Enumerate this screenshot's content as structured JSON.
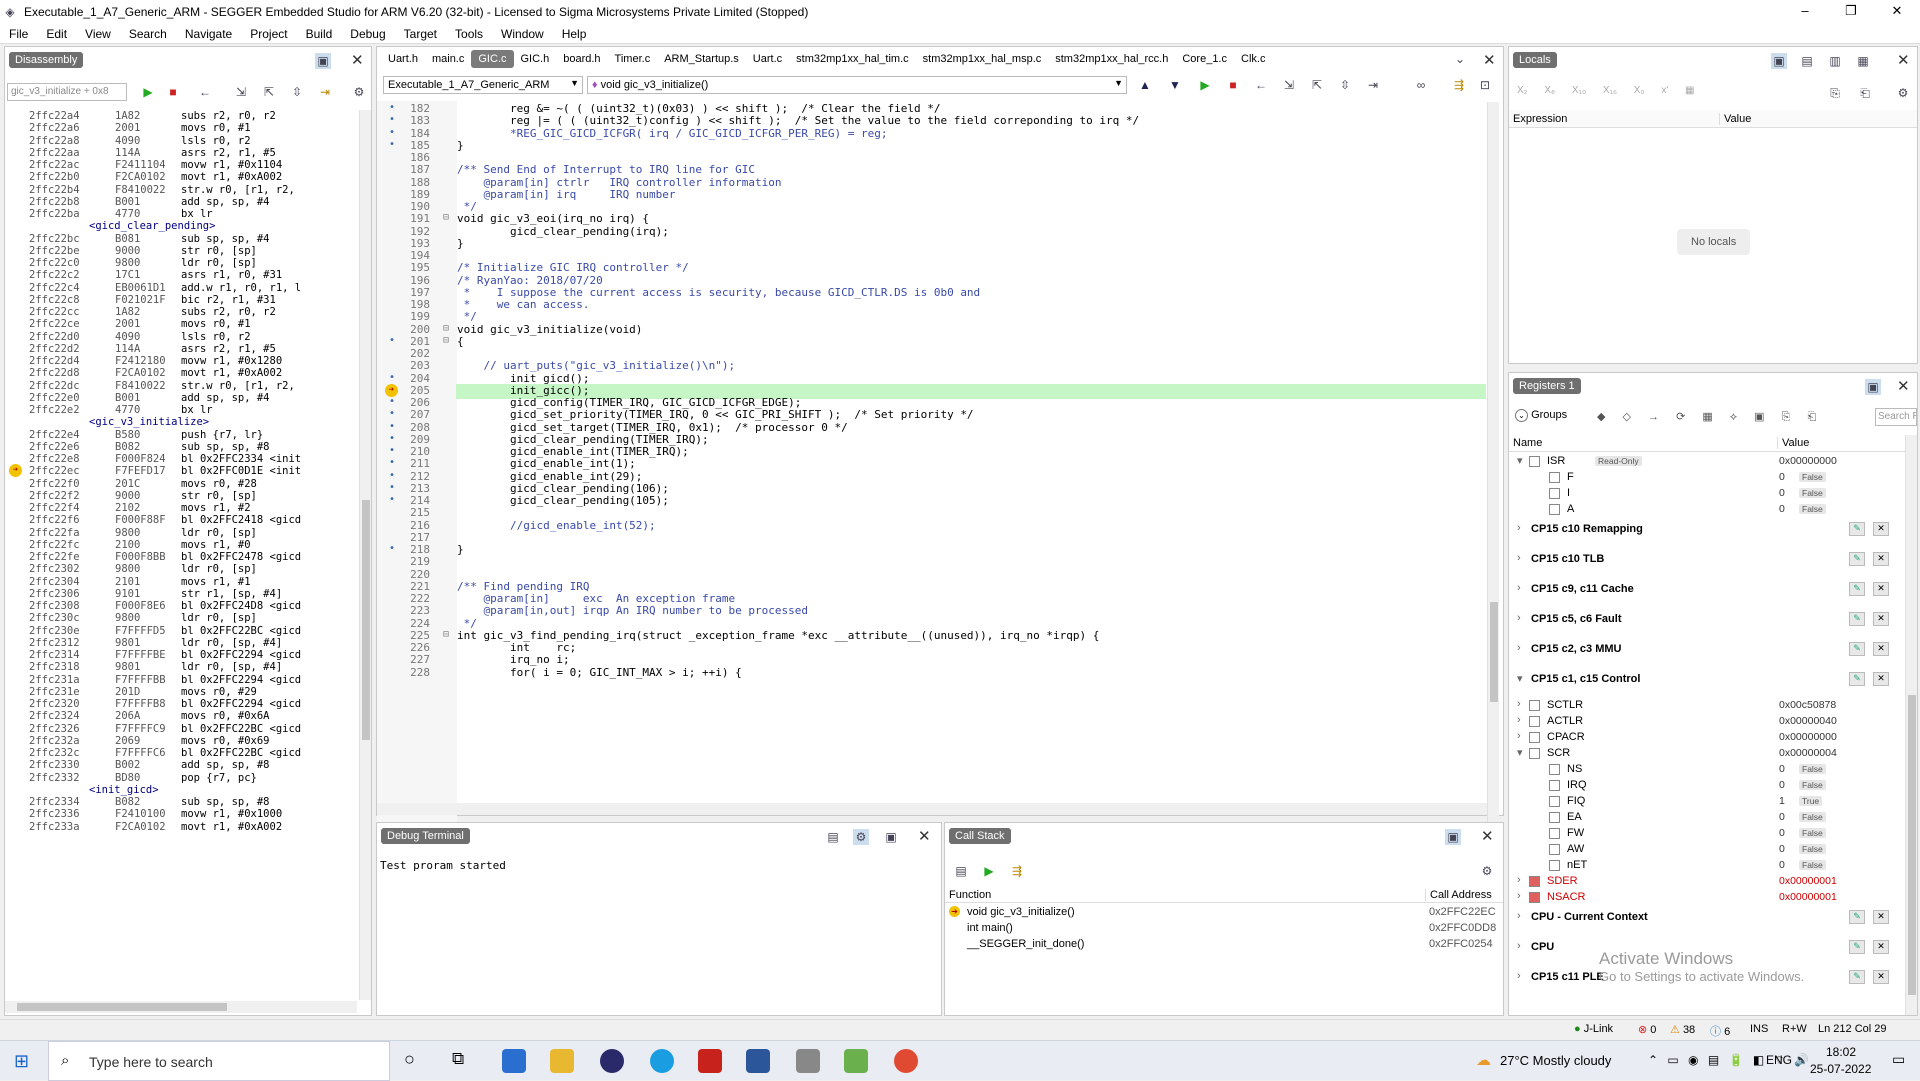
{
  "window": {
    "title": "Executable_1_A7_Generic_ARM - SEGGER Embedded Studio for ARM V6.20 (32-bit) - Licensed to Sigma Microsystems Private Limited (Stopped)"
  },
  "menu": [
    "File",
    "Edit",
    "View",
    "Search",
    "Navigate",
    "Project",
    "Build",
    "Debug",
    "Target",
    "Tools",
    "Window",
    "Help"
  ],
  "disassembly": {
    "title": "Disassembly",
    "address_input": "gic_v3_initialize + 0x8",
    "lines": [
      [
        "2ffc22a4",
        "1A82",
        "subs r2, r0, r2"
      ],
      [
        "2ffc22a6",
        "2001",
        "movs r0, #1"
      ],
      [
        "2ffc22a8",
        "4090",
        "lsls r0, r2"
      ],
      [
        "2ffc22aa",
        "114A",
        "asrs r2, r1, #5"
      ],
      [
        "2ffc22ac",
        "F2411104",
        "movw r1, #0x1104"
      ],
      [
        "2ffc22b0",
        "F2CA0102",
        "movt r1, #0xA002"
      ],
      [
        "2ffc22b4",
        "F8410022",
        "str.w r0, [r1, r2,"
      ],
      [
        "2ffc22b8",
        "B001",
        "add sp, sp, #4"
      ],
      [
        "2ffc22ba",
        "4770",
        "bx lr"
      ],
      [
        "",
        "<gicd_clear_pending>",
        ""
      ],
      [
        "2ffc22bc",
        "B081",
        "sub sp, sp, #4"
      ],
      [
        "2ffc22be",
        "9000",
        "str r0, [sp]"
      ],
      [
        "2ffc22c0",
        "9800",
        "ldr r0, [sp]"
      ],
      [
        "2ffc22c2",
        "17C1",
        "asrs r1, r0, #31"
      ],
      [
        "2ffc22c4",
        "EB0061D1",
        "add.w r1, r0, r1, l"
      ],
      [
        "2ffc22c8",
        "F021021F",
        "bic r2, r1, #31"
      ],
      [
        "2ffc22cc",
        "1A82",
        "subs r2, r0, r2"
      ],
      [
        "2ffc22ce",
        "2001",
        "movs r0, #1"
      ],
      [
        "2ffc22d0",
        "4090",
        "lsls r0, r2"
      ],
      [
        "2ffc22d2",
        "114A",
        "asrs r2, r1, #5"
      ],
      [
        "2ffc22d4",
        "F2412180",
        "movw r1, #0x1280"
      ],
      [
        "2ffc22d8",
        "F2CA0102",
        "movt r1, #0xA002"
      ],
      [
        "2ffc22dc",
        "F8410022",
        "str.w r0, [r1, r2,"
      ],
      [
        "2ffc22e0",
        "B001",
        "add sp, sp, #4"
      ],
      [
        "2ffc22e2",
        "4770",
        "bx lr"
      ],
      [
        "",
        "<gic_v3_initialize>",
        ""
      ],
      [
        "2ffc22e4",
        "B580",
        "push {r7, lr}"
      ],
      [
        "2ffc22e6",
        "B082",
        "sub sp, sp, #8"
      ],
      [
        "2ffc22e8",
        "F000F824",
        "bl 0x2FFC2334 <init"
      ],
      [
        "2ffc22ec",
        "F7FEFD17",
        "bl 0x2FFC0D1E <init"
      ],
      [
        "2ffc22f0",
        "201C",
        "movs r0, #28"
      ],
      [
        "2ffc22f2",
        "9000",
        "str r0, [sp]"
      ],
      [
        "2ffc22f4",
        "2102",
        "movs r1, #2"
      ],
      [
        "2ffc22f6",
        "F000F88F",
        "bl 0x2FFC2418 <gicd"
      ],
      [
        "2ffc22fa",
        "9800",
        "ldr r0, [sp]"
      ],
      [
        "2ffc22fc",
        "2100",
        "movs r1, #0"
      ],
      [
        "2ffc22fe",
        "F000F8BB",
        "bl 0x2FFC2478 <gicd"
      ],
      [
        "2ffc2302",
        "9800",
        "ldr r0, [sp]"
      ],
      [
        "2ffc2304",
        "2101",
        "movs r1, #1"
      ],
      [
        "2ffc2306",
        "9101",
        "str r1, [sp, #4]"
      ],
      [
        "2ffc2308",
        "F000F8E6",
        "bl 0x2FFC24D8 <gicd"
      ],
      [
        "2ffc230c",
        "9800",
        "ldr r0, [sp]"
      ],
      [
        "2ffc230e",
        "F7FFFFD5",
        "bl 0x2FFC22BC <gicd"
      ],
      [
        "2ffc2312",
        "9801",
        "ldr r0, [sp, #4]"
      ],
      [
        "2ffc2314",
        "F7FFFFBE",
        "bl 0x2FFC2294 <gicd"
      ],
      [
        "2ffc2318",
        "9801",
        "ldr r0, [sp, #4]"
      ],
      [
        "2ffc231a",
        "F7FFFFBB",
        "bl 0x2FFC2294 <gicd"
      ],
      [
        "2ffc231e",
        "201D",
        "movs r0, #29"
      ],
      [
        "2ffc2320",
        "F7FFFFB8",
        "bl 0x2FFC2294 <gicd"
      ],
      [
        "2ffc2324",
        "206A",
        "movs r0, #0x6A"
      ],
      [
        "2ffc2326",
        "F7FFFFC9",
        "bl 0x2FFC22BC <gicd"
      ],
      [
        "2ffc232a",
        "2069",
        "movs r0, #0x69"
      ],
      [
        "2ffc232c",
        "F7FFFFC6",
        "bl 0x2FFC22BC <gicd"
      ],
      [
        "2ffc2330",
        "B002",
        "add sp, sp, #8"
      ],
      [
        "2ffc2332",
        "BD80",
        "pop {r7, pc}"
      ],
      [
        "",
        "<init_gicd>",
        ""
      ],
      [
        "2ffc2334",
        "B082",
        "sub sp, sp, #8"
      ],
      [
        "2ffc2336",
        "F2410100",
        "movw r1, #0x1000"
      ],
      [
        "2ffc233a",
        "F2CA0102",
        "movt r1, #0xA002"
      ]
    ]
  },
  "editor": {
    "tabs": [
      "Uart.h",
      "main.c",
      "GIC.c",
      "GIC.h",
      "board.h",
      "Timer.c",
      "ARM_Startup.s",
      "Uart.c",
      "stm32mp1xx_hal_tim.c",
      "stm32mp1xx_hal_msp.c",
      "stm32mp1xx_hal_rcc.h",
      "Core_1.c",
      "Clk.c"
    ],
    "active_tab": "GIC.c",
    "project_dropdown": "Executable_1_A7_Generic_ARM",
    "function_dropdown": "void gic_v3_initialize()",
    "lines": [
      [
        "182",
        "        reg &= ~( ( (uint32_t)(0x03) ) << shift );  /* Clear the field */"
      ],
      [
        "183",
        "        reg |= ( ( (uint32_t)config ) << shift );  /* Set the value to the field correponding to irq */"
      ],
      [
        "184",
        "        *REG_GIC_GICD_ICFGR( irq / GIC_GICD_ICFGR_PER_REG) = reg;"
      ],
      [
        "185",
        "}"
      ],
      [
        "186",
        ""
      ],
      [
        "187",
        "/** Send End of Interrupt to IRQ line for GIC"
      ],
      [
        "188",
        "    @param[in] ctrlr   IRQ controller information"
      ],
      [
        "189",
        "    @param[in] irq     IRQ number"
      ],
      [
        "190",
        " */"
      ],
      [
        "191",
        "void gic_v3_eoi(irq_no irq) {"
      ],
      [
        "192",
        "        gicd_clear_pending(irq);"
      ],
      [
        "193",
        "}"
      ],
      [
        "194",
        ""
      ],
      [
        "195",
        "/* Initialize GIC IRQ controller */"
      ],
      [
        "196",
        "/* RyanYao: 2018/07/20"
      ],
      [
        "197",
        " *    I suppose the current access is security, because GICD_CTLR.DS is 0b0 and"
      ],
      [
        "198",
        " *    we can access."
      ],
      [
        "199",
        " */"
      ],
      [
        "200",
        "void gic_v3_initialize(void)"
      ],
      [
        "201",
        "{"
      ],
      [
        "202",
        ""
      ],
      [
        "203",
        "    // uart_puts(\"gic_v3_initialize()\\n\");"
      ],
      [
        "204",
        "        init_gicd();"
      ],
      [
        "205",
        "        init_gicc();"
      ],
      [
        "206",
        "        gicd_config(TIMER_IRQ, GIC_GICD_ICFGR_EDGE);"
      ],
      [
        "207",
        "        gicd_set_priority(TIMER_IRQ, 0 << GIC_PRI_SHIFT );  /* Set priority */"
      ],
      [
        "208",
        "        gicd_set_target(TIMER_IRQ, 0x1);  /* processor 0 */"
      ],
      [
        "209",
        "        gicd_clear_pending(TIMER_IRQ);"
      ],
      [
        "210",
        "        gicd_enable_int(TIMER_IRQ);"
      ],
      [
        "211",
        "        gicd_enable_int(1);"
      ],
      [
        "212",
        "        gicd_enable_int(29);"
      ],
      [
        "213",
        "        gicd_clear_pending(106);"
      ],
      [
        "214",
        "        gicd_clear_pending(105);"
      ],
      [
        "215",
        ""
      ],
      [
        "216",
        "        //gicd_enable_int(52);"
      ],
      [
        "217",
        ""
      ],
      [
        "218",
        "}"
      ],
      [
        "219",
        ""
      ],
      [
        "220",
        ""
      ],
      [
        "221",
        "/** Find pending IRQ"
      ],
      [
        "222",
        "    @param[in]     exc  An exception frame"
      ],
      [
        "223",
        "    @param[in,out] irqp An IRQ number to be processed"
      ],
      [
        "224",
        " */"
      ],
      [
        "225",
        "int gic_v3_find_pending_irq(struct _exception_frame *exc __attribute__((unused)), irq_no *irqp) {"
      ],
      [
        "226",
        "        int    rc;"
      ],
      [
        "227",
        "        irq_no i;"
      ],
      [
        "228",
        "        for( i = 0; GIC_INT_MAX > i; ++i) {"
      ]
    ]
  },
  "locals": {
    "title": "Locals",
    "col_expression": "Expression",
    "col_value": "Value",
    "empty": "No locals"
  },
  "registers": {
    "title": "Registers 1",
    "groups_label": "Groups",
    "search_placeholder": "Search R",
    "col_name": "Name",
    "col_value": "Value",
    "rows": [
      {
        "kind": "reg",
        "name": "ISR",
        "value": "0x00000000",
        "badge": "Read-Only",
        "indent": 1
      },
      {
        "kind": "bit",
        "name": "F",
        "value": "0",
        "flag": "False",
        "indent": 2
      },
      {
        "kind": "bit",
        "name": "I",
        "value": "0",
        "flag": "False",
        "indent": 2
      },
      {
        "kind": "bit",
        "name": "A",
        "value": "0",
        "flag": "False",
        "indent": 2
      },
      {
        "kind": "group",
        "name": "CP15 c10 Remapping"
      },
      {
        "kind": "group",
        "name": "CP15 c10 TLB"
      },
      {
        "kind": "group",
        "name": "CP15 c9, c11 Cache"
      },
      {
        "kind": "group",
        "name": "CP15 c5, c6 Fault"
      },
      {
        "kind": "group",
        "name": "CP15 c2, c3 MMU"
      },
      {
        "kind": "group",
        "name": "CP15 c1, c15 Control"
      },
      {
        "kind": "reg",
        "name": "SCTLR",
        "value": "0x00c50878",
        "indent": 1
      },
      {
        "kind": "reg",
        "name": "ACTLR",
        "value": "0x00000040",
        "indent": 1
      },
      {
        "kind": "reg",
        "name": "CPACR",
        "value": "0x00000000",
        "indent": 1
      },
      {
        "kind": "reg",
        "name": "SCR",
        "value": "0x00000004",
        "indent": 1
      },
      {
        "kind": "bit",
        "name": "NS",
        "value": "0",
        "flag": "False",
        "indent": 2
      },
      {
        "kind": "bit",
        "name": "IRQ",
        "value": "0",
        "flag": "False",
        "indent": 2
      },
      {
        "kind": "bit",
        "name": "FIQ",
        "value": "1",
        "flag": "True",
        "indent": 2
      },
      {
        "kind": "bit",
        "name": "EA",
        "value": "0",
        "flag": "False",
        "indent": 2
      },
      {
        "kind": "bit",
        "name": "FW",
        "value": "0",
        "flag": "False",
        "indent": 2
      },
      {
        "kind": "bit",
        "name": "AW",
        "value": "0",
        "flag": "False",
        "indent": 2
      },
      {
        "kind": "bit",
        "name": "nET",
        "value": "0",
        "flag": "False",
        "indent": 2
      },
      {
        "kind": "reg",
        "name": "SDER",
        "value": "0x00000001",
        "indent": 1,
        "red": true
      },
      {
        "kind": "reg",
        "name": "NSACR",
        "value": "0x00000001",
        "indent": 1,
        "red": true
      },
      {
        "kind": "group",
        "name": "CPU - Current Context"
      },
      {
        "kind": "group",
        "name": "CPU"
      },
      {
        "kind": "group",
        "name": "CP15 c11 PLE"
      }
    ]
  },
  "terminal": {
    "title": "Debug Terminal",
    "output": "Test proram started"
  },
  "callstack": {
    "title": "Call Stack",
    "col_function": "Function",
    "col_address": "Call Address",
    "rows": [
      {
        "fn": "void gic_v3_initialize()",
        "addr": "0x2FFC22EC"
      },
      {
        "fn": "int main()",
        "addr": "0x2FFC0DD8"
      },
      {
        "fn": "__SEGGER_init_done()",
        "addr": "0x2FFC0254"
      }
    ]
  },
  "watermark": {
    "line1": "Activate Windows",
    "line2": "Go to Settings to activate Windows."
  },
  "statusbar": {
    "jlink": "J-Link",
    "errors": "0",
    "warnings": "38",
    "info": "6",
    "mode": "INS",
    "rw": "R+W",
    "position": "Ln 212 Col 29"
  },
  "taskbar": {
    "search_placeholder": "Type here to search",
    "weather": "27°C  Mostly cloudy",
    "lang": "ENG",
    "time": "18:02",
    "date": "25-07-2022"
  }
}
